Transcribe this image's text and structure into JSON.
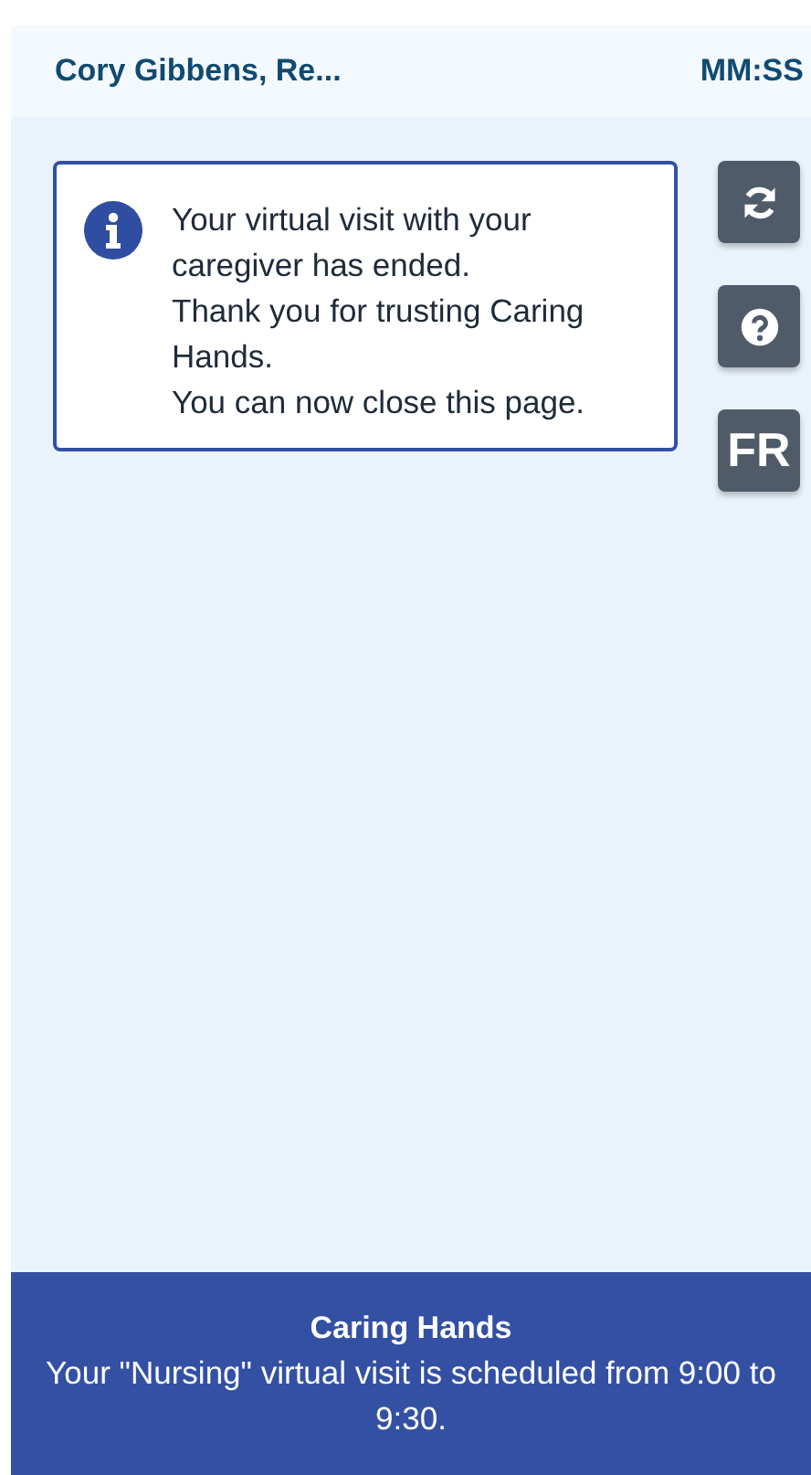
{
  "header": {
    "title": "Cory Gibbens, Re...",
    "timer": "MM:SS"
  },
  "message": {
    "kind": "info",
    "lines": [
      "Your virtual visit with your caregiver has ended.",
      "Thank you for trusting Caring Hands.",
      "You can now close this page."
    ]
  },
  "side_buttons": [
    {
      "kind": "refresh"
    },
    {
      "kind": "help"
    },
    {
      "kind": "text",
      "label": "FR"
    }
  ],
  "footer": {
    "title": "Caring Hands",
    "text": "Your \"Nursing\" virtual visit is scheduled from 9:00 to 9:30."
  }
}
